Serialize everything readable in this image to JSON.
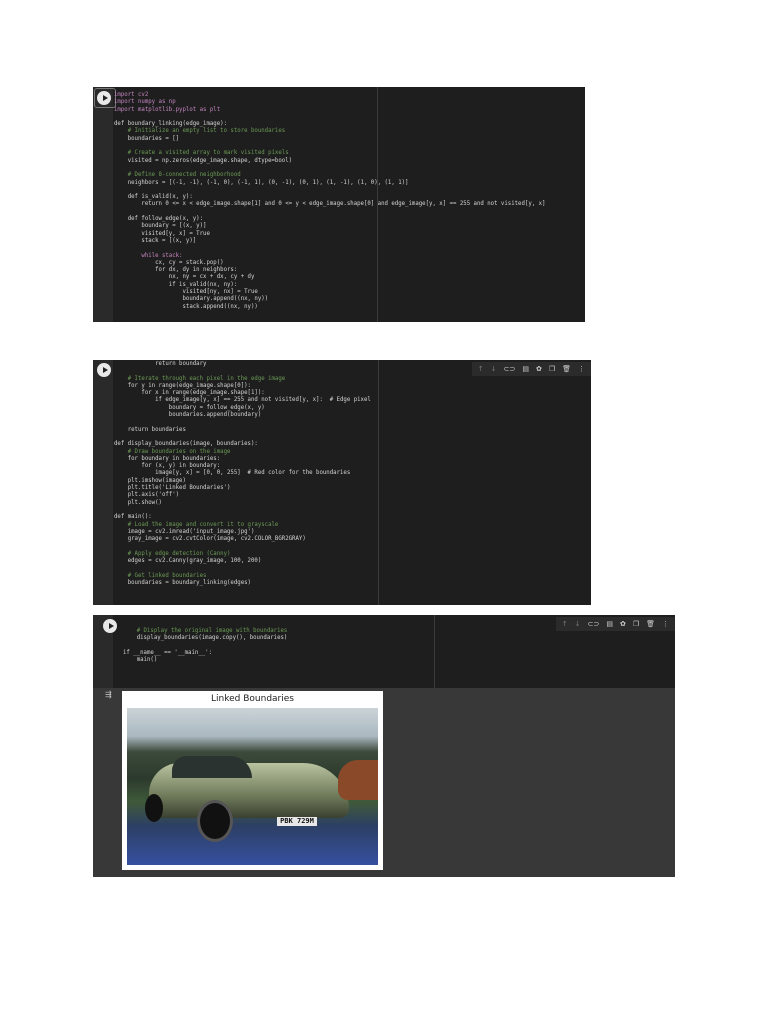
{
  "cells": [
    {
      "lines": [
        {
          "t": "import cv2",
          "k": "kw"
        },
        {
          "t": "import numpy as np",
          "k": "kw"
        },
        {
          "t": "import matplotlib.pyplot as plt",
          "k": "kw"
        },
        {
          "t": "",
          "k": ""
        },
        {
          "t": "def boundary_linking(edge_image):",
          "k": ""
        },
        {
          "t": "    # Initialize an empty list to store boundaries",
          "k": "cm"
        },
        {
          "t": "    boundaries = []",
          "k": ""
        },
        {
          "t": "",
          "k": ""
        },
        {
          "t": "    # Create a visited array to mark visited pixels",
          "k": "cm"
        },
        {
          "t": "    visited = np.zeros(edge_image.shape, dtype=bool)",
          "k": ""
        },
        {
          "t": "",
          "k": ""
        },
        {
          "t": "    # Define 8-connected neighborhood",
          "k": "cm"
        },
        {
          "t": "    neighbors = [(-1, -1), (-1, 0), (-1, 1), (0, -1), (0, 1), (1, -1), (1, 0), (1, 1)]",
          "k": ""
        },
        {
          "t": "",
          "k": ""
        },
        {
          "t": "    def is_valid(x, y):",
          "k": ""
        },
        {
          "t": "        return 0 <= x < edge_image.shape[1] and 0 <= y < edge_image.shape[0] and edge_image[y, x] == 255 and not visited[y, x]",
          "k": ""
        },
        {
          "t": "",
          "k": ""
        },
        {
          "t": "    def follow_edge(x, y):",
          "k": ""
        },
        {
          "t": "        boundary = [(x, y)]",
          "k": ""
        },
        {
          "t": "        visited[y, x] = True",
          "k": ""
        },
        {
          "t": "        stack = [(x, y)]",
          "k": ""
        },
        {
          "t": "",
          "k": ""
        },
        {
          "t": "        while stack:",
          "k": "kw"
        },
        {
          "t": "            cx, cy = stack.pop()",
          "k": ""
        },
        {
          "t": "            for dx, dy in neighbors:",
          "k": ""
        },
        {
          "t": "                nx, ny = cx + dx, cy + dy",
          "k": ""
        },
        {
          "t": "                if is_valid(nx, ny):",
          "k": ""
        },
        {
          "t": "                    visited[ny, nx] = True",
          "k": ""
        },
        {
          "t": "                    boundary.append((nx, ny))",
          "k": ""
        },
        {
          "t": "                    stack.append((nx, ny))",
          "k": ""
        }
      ]
    },
    {
      "lines": [
        {
          "t": "            return boundary",
          "k": ""
        },
        {
          "t": "",
          "k": ""
        },
        {
          "t": "    # Iterate through each pixel in the edge image",
          "k": "cm"
        },
        {
          "t": "    for y in range(edge_image.shape[0]):",
          "k": ""
        },
        {
          "t": "        for x in range(edge_image.shape[1]):",
          "k": ""
        },
        {
          "t": "            if edge_image[y, x] == 255 and not visited[y, x]:  # Edge pixel",
          "k": ""
        },
        {
          "t": "                boundary = follow_edge(x, y)",
          "k": ""
        },
        {
          "t": "                boundaries.append(boundary)",
          "k": ""
        },
        {
          "t": "",
          "k": ""
        },
        {
          "t": "    return boundaries",
          "k": ""
        },
        {
          "t": "",
          "k": ""
        },
        {
          "t": "def display_boundaries(image, boundaries):",
          "k": ""
        },
        {
          "t": "    # Draw boundaries on the image",
          "k": "cm"
        },
        {
          "t": "    for boundary in boundaries:",
          "k": ""
        },
        {
          "t": "        for (x, y) in boundary:",
          "k": ""
        },
        {
          "t": "            image[y, x] = [0, 0, 255]  # Red color for the boundaries",
          "k": ""
        },
        {
          "t": "    plt.imshow(image)",
          "k": ""
        },
        {
          "t": "    plt.title('Linked Boundaries')",
          "k": ""
        },
        {
          "t": "    plt.axis('off')",
          "k": ""
        },
        {
          "t": "    plt.show()",
          "k": ""
        },
        {
          "t": "",
          "k": ""
        },
        {
          "t": "def main():",
          "k": ""
        },
        {
          "t": "    # Load the image and convert it to grayscale",
          "k": "cm"
        },
        {
          "t": "    image = cv2.imread('input_image.jpg')",
          "k": ""
        },
        {
          "t": "    gray_image = cv2.cvtColor(image, cv2.COLOR_BGR2GRAY)",
          "k": ""
        },
        {
          "t": "",
          "k": ""
        },
        {
          "t": "    # Apply edge detection (Canny)",
          "k": "cm"
        },
        {
          "t": "    edges = cv2.Canny(gray_image, 100, 200)",
          "k": ""
        },
        {
          "t": "",
          "k": ""
        },
        {
          "t": "    # Get linked boundaries",
          "k": "cm"
        },
        {
          "t": "    boundaries = boundary_linking(edges)",
          "k": ""
        }
      ]
    },
    {
      "lines": [
        {
          "t": "    # Display the original image with boundaries",
          "k": "cm"
        },
        {
          "t": "    display_boundaries(image.copy(), boundaries)",
          "k": ""
        },
        {
          "t": "",
          "k": ""
        },
        {
          "t": "if __name__ == '__main__':",
          "k": ""
        },
        {
          "t": "    main()",
          "k": ""
        }
      ]
    }
  ],
  "toolbar": {
    "up": "↑",
    "down": "↓",
    "link": "⊂⊃",
    "comment": "▤",
    "settings": "✿",
    "copy": "❐",
    "delete": "🗑",
    "more": "⋮"
  },
  "output": {
    "figure_title": "Linked Boundaries",
    "plate": "PBK 729M",
    "output_icon": "⇶"
  }
}
